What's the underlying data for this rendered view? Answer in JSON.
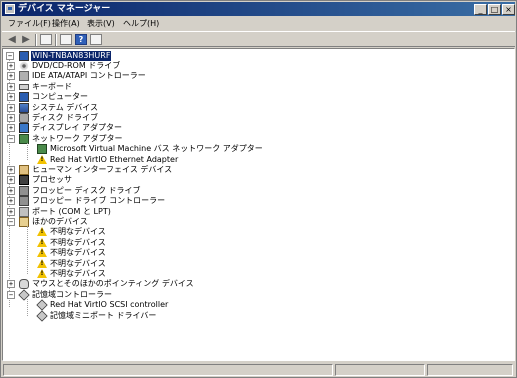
{
  "window": {
    "title": "デバイス マネージャー",
    "controls": {
      "minimize": "_",
      "maximize": "□",
      "close": "×"
    }
  },
  "menu": [
    {
      "label": "ファイル(F)"
    },
    {
      "label": "操作(A)"
    },
    {
      "label": "表示(V)"
    },
    {
      "label": "ヘルプ(H)"
    }
  ],
  "toolbar": {
    "buttons": [
      "back-arrow-icon",
      "forward-arrow-icon",
      "properties-icon",
      "tree-view-icon",
      "help-icon",
      "scan-icon"
    ],
    "back_glyph": "◀",
    "forward_glyph": "▶",
    "help_glyph": "?"
  },
  "tree": {
    "computer": "WIN-TNBAN83HURF",
    "categories": [
      {
        "label": "DVD/CD-ROM ドライブ",
        "expander": "+"
      },
      {
        "label": "IDE ATA/ATAPI コントローラー",
        "expander": "+"
      },
      {
        "label": "キーボード",
        "expander": "+"
      },
      {
        "label": "コンピューター",
        "expander": "+"
      },
      {
        "label": "システム デバイス",
        "expander": "+"
      },
      {
        "label": "ディスク ドライブ",
        "expander": "+"
      },
      {
        "label": "ディスプレイ アダプター",
        "expander": "+"
      },
      {
        "label": "ネットワーク アダプター",
        "expander": "−"
      },
      {
        "label": "Microsoft Virtual Machine バス ネットワーク アダプター"
      },
      {
        "label": "Red Hat VirtIO Ethernet Adapter"
      },
      {
        "label": "ヒューマン インターフェイス デバイス",
        "expander": "+"
      },
      {
        "label": "プロセッサ",
        "expander": "+"
      },
      {
        "label": "フロッピー ディスク ドライブ",
        "expander": "+"
      },
      {
        "label": "フロッピー ドライブ コントローラー",
        "expander": "+"
      },
      {
        "label": "ポート (COM と LPT)",
        "expander": "+"
      },
      {
        "label": "ほかのデバイス",
        "expander": "−"
      },
      {
        "label": "不明なデバイス"
      },
      {
        "label": "不明なデバイス"
      },
      {
        "label": "不明なデバイス"
      },
      {
        "label": "不明なデバイス"
      },
      {
        "label": "不明なデバイス"
      },
      {
        "label": "マウスとそのほかのポインティング デバイス",
        "expander": "+"
      },
      {
        "label": "記憶域コントローラー",
        "expander": "−"
      },
      {
        "label": "Red Hat VirtIO SCSI controller"
      },
      {
        "label": "記憶域ミニポート ドライバー"
      }
    ]
  },
  "colors": {
    "titlebar": "#0a246a",
    "selection": "#0a246a",
    "warning": "#f2c200",
    "chrome": "#d4d0c8"
  }
}
